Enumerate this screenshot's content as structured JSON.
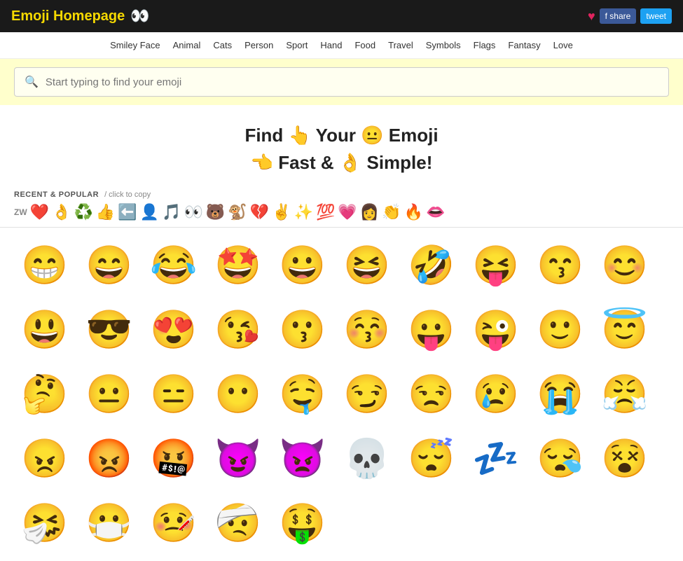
{
  "header": {
    "title": "Emoji Homepage",
    "eyes": "👀",
    "heart": "♥",
    "fb_share": "f share",
    "tweet": "tweet"
  },
  "nav": {
    "items": [
      "Smiley Face",
      "Animal",
      "Cats",
      "Person",
      "Sport",
      "Hand",
      "Food",
      "Travel",
      "Symbols",
      "Flags",
      "Fantasy",
      "Love"
    ]
  },
  "search": {
    "placeholder": "Start typing to find your emoji"
  },
  "hero": {
    "line1": "Find 👆 Your 😐 Emoji",
    "line2": "👈 Fast & 👌 Simple!"
  },
  "recent": {
    "label": "RECENT & POPULAR",
    "sub": "/ click to copy",
    "emojis": [
      "ZW",
      "❤️",
      "👌",
      "♻️",
      "👍",
      "⬅️",
      "👤",
      "🎵",
      "👀",
      "🐻",
      "🐒",
      "💔",
      "✌️",
      "✨",
      "💯",
      "💗",
      "👩",
      "👏",
      "🔥",
      "👄"
    ]
  },
  "grid": {
    "emojis": [
      "😁",
      "😄",
      "😂",
      "🤩",
      "😀",
      "😆",
      "🤣",
      "😝",
      "😙",
      "😊",
      "😃",
      "😎",
      "😍",
      "😘",
      "😗",
      "😚",
      "😛",
      "😜",
      "🙂",
      "😇",
      "🤔",
      "😐",
      "😑",
      "😶",
      "🤤",
      "😏",
      "😒",
      "😢",
      "😭",
      "😤",
      "😠",
      "😡",
      "🤬",
      "😈",
      "👿",
      "💀",
      "😴",
      "💤",
      "😪",
      "😵",
      "🤧",
      "😷",
      "🤒",
      "🤕",
      "🤑"
    ]
  }
}
